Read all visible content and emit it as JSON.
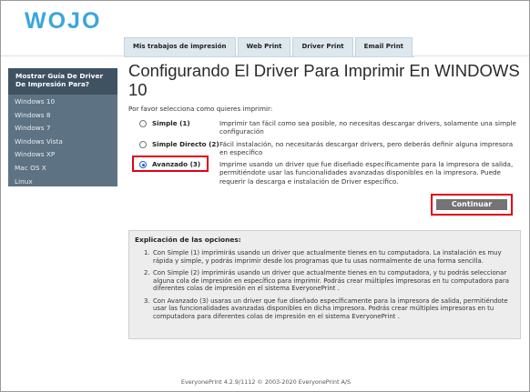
{
  "brand": {
    "logo_text": "WOJO",
    "color": "#3aa6dd"
  },
  "tabs": [
    {
      "label": "Mis trabajos de impresión"
    },
    {
      "label": "Web Print"
    },
    {
      "label": "Driver Print"
    },
    {
      "label": "Email Print"
    }
  ],
  "sidebar": {
    "header": "Mostrar Guía De Driver De Impresión Para?",
    "items": [
      {
        "label": "Windows 10"
      },
      {
        "label": "Windows 8"
      },
      {
        "label": "Windows 7"
      },
      {
        "label": "Windows Vista"
      },
      {
        "label": "Windows XP"
      },
      {
        "label": "Mac OS X"
      },
      {
        "label": "Linux"
      }
    ]
  },
  "main": {
    "title": "Configurando El Driver Para Imprimir En WINDOWS 10",
    "prompt": "Por favor selecciona como quieres imprimir:",
    "options": [
      {
        "label": "Simple (1)",
        "selected": false,
        "description": "Imprimir tan fácil como sea posible, no necesitas descargar drivers, solamente una simple configuración"
      },
      {
        "label": "Simple Directo (2)",
        "selected": false,
        "description": "Fácil instalación, no necesitarás descargar drivers, pero deberás definir alguna impresora en específico"
      },
      {
        "label": "Avanzado (3)",
        "selected": true,
        "description": "Imprime usando un driver que fue diseñado específicamente para la impresora de salida, permitiéndote usar las funcionalidades avanzadas disponibles en la impresora. Puede requerir la descarga e instalación de Driver específico."
      }
    ],
    "continue_label": "Continuar"
  },
  "explanation": {
    "title": "Explicación de las opciones:",
    "items": [
      {
        "num": "1.",
        "text": "Con Simple (1) imprimirás usando un driver que actualmente tienes en tu computadora. La instalación es muy rápida y simple, y podrás imprimir desde los programas que tu usas normalmente de una forma sencilla."
      },
      {
        "num": "2.",
        "text": "Con Simple (2) imprimirás usando un driver que actualmente tienes en tu computadora, y tu podrás seleccionar alguna cola de impresión en específico para imprimir. Podrás crear múltiples impresoras en tu computadora para diferentes colas de impresión en el sistema EveryonePrint ."
      },
      {
        "num": "3.",
        "text": "Con Avanzado (3) usaras un driver que fue diseñado específicamente para la impresora de salida, permitiéndote usar las funcionalidades avanzadas disponibles en dicha impresora. Podrás crear múltiples impresoras en tu computadora para diferentes colas de impresión en el sistema EveryonePrint ."
      }
    ]
  },
  "footer": {
    "text": "EveryonePrint 4.2.9/1112 © 2003-2020 EveryonePrint A/S"
  },
  "colors": {
    "highlight": "#e0001b",
    "sidebar": "#5d7282",
    "sidebar_header": "#3f5262"
  }
}
